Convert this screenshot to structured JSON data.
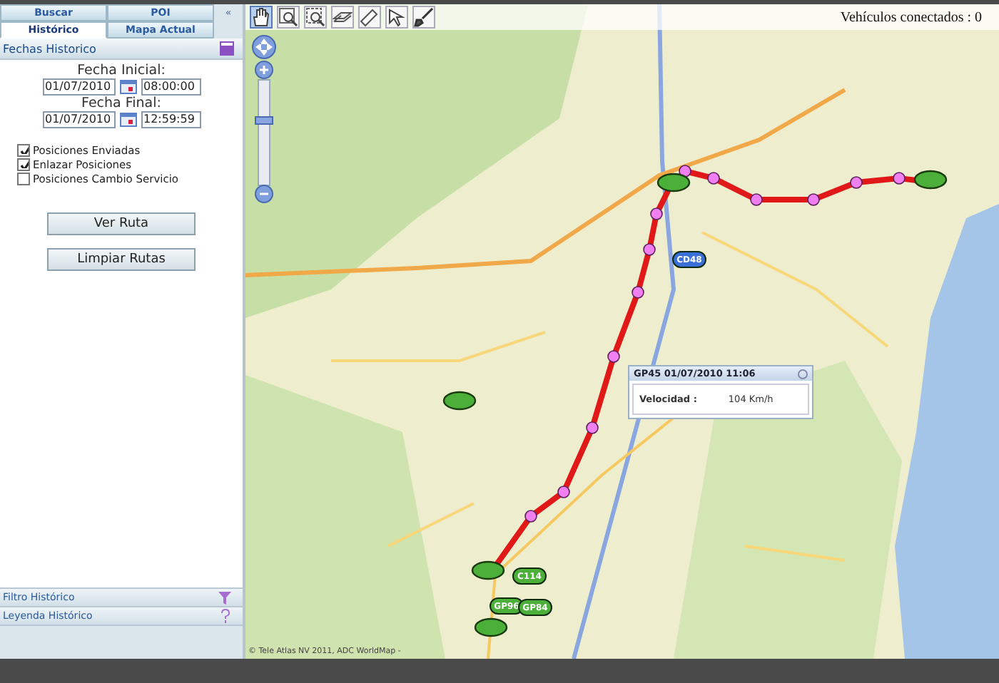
{
  "tab_rows": [
    [
      {
        "label": "Buscar",
        "selected": false
      },
      {
        "label": "POI",
        "selected": false
      }
    ],
    [
      {
        "label": "Histórico",
        "selected": true
      },
      {
        "label": "Mapa Actual",
        "selected": false
      }
    ]
  ],
  "collapse_label": "«",
  "fechas": {
    "title": "Fechas Historico",
    "start_label": "Fecha Inicial:",
    "start_date": "01/07/2010",
    "start_time": "08:00:00",
    "end_label": "Fecha Final:",
    "end_date": "01/07/2010",
    "end_time": "12:59:59"
  },
  "options": [
    {
      "label": "Posiciones Enviadas",
      "checked": true
    },
    {
      "label": "Enlazar Posiciones",
      "checked": true
    },
    {
      "label": "Posiciones Cambio Servicio",
      "checked": false
    }
  ],
  "buttons": [
    "Ver Ruta",
    "Limpiar Rutas"
  ],
  "sections": [
    {
      "label": "Filtro Histórico",
      "kind": "filter"
    },
    {
      "label": "Leyenda Histórico",
      "kind": "help"
    }
  ],
  "tools": [
    {
      "kind": "hand",
      "selected": true
    },
    {
      "kind": "zoom-in",
      "selected": false
    },
    {
      "kind": "zoom-out",
      "selected": false
    },
    {
      "kind": "layers",
      "selected": false
    },
    {
      "kind": "ruler",
      "selected": false
    },
    {
      "kind": "pointer",
      "selected": false
    },
    {
      "kind": "brush",
      "selected": false
    }
  ],
  "vehicles_connected": "Vehículos conectados : 0",
  "vehicles": [
    {
      "label": "CD48",
      "color": "#3a6fd8"
    },
    {
      "label": "C114",
      "color": "#4caf3a"
    },
    {
      "label": "GP96",
      "color": "#4caf3a"
    },
    {
      "label": "GP84",
      "color": "#4caf3a"
    }
  ],
  "popup": {
    "title": "GP45  01/07/2010 11:06",
    "field": "Velocidad :",
    "value": "104 Km/h"
  },
  "copyright": "© Tele Atlas NV 2011, ADC WorldMap -"
}
